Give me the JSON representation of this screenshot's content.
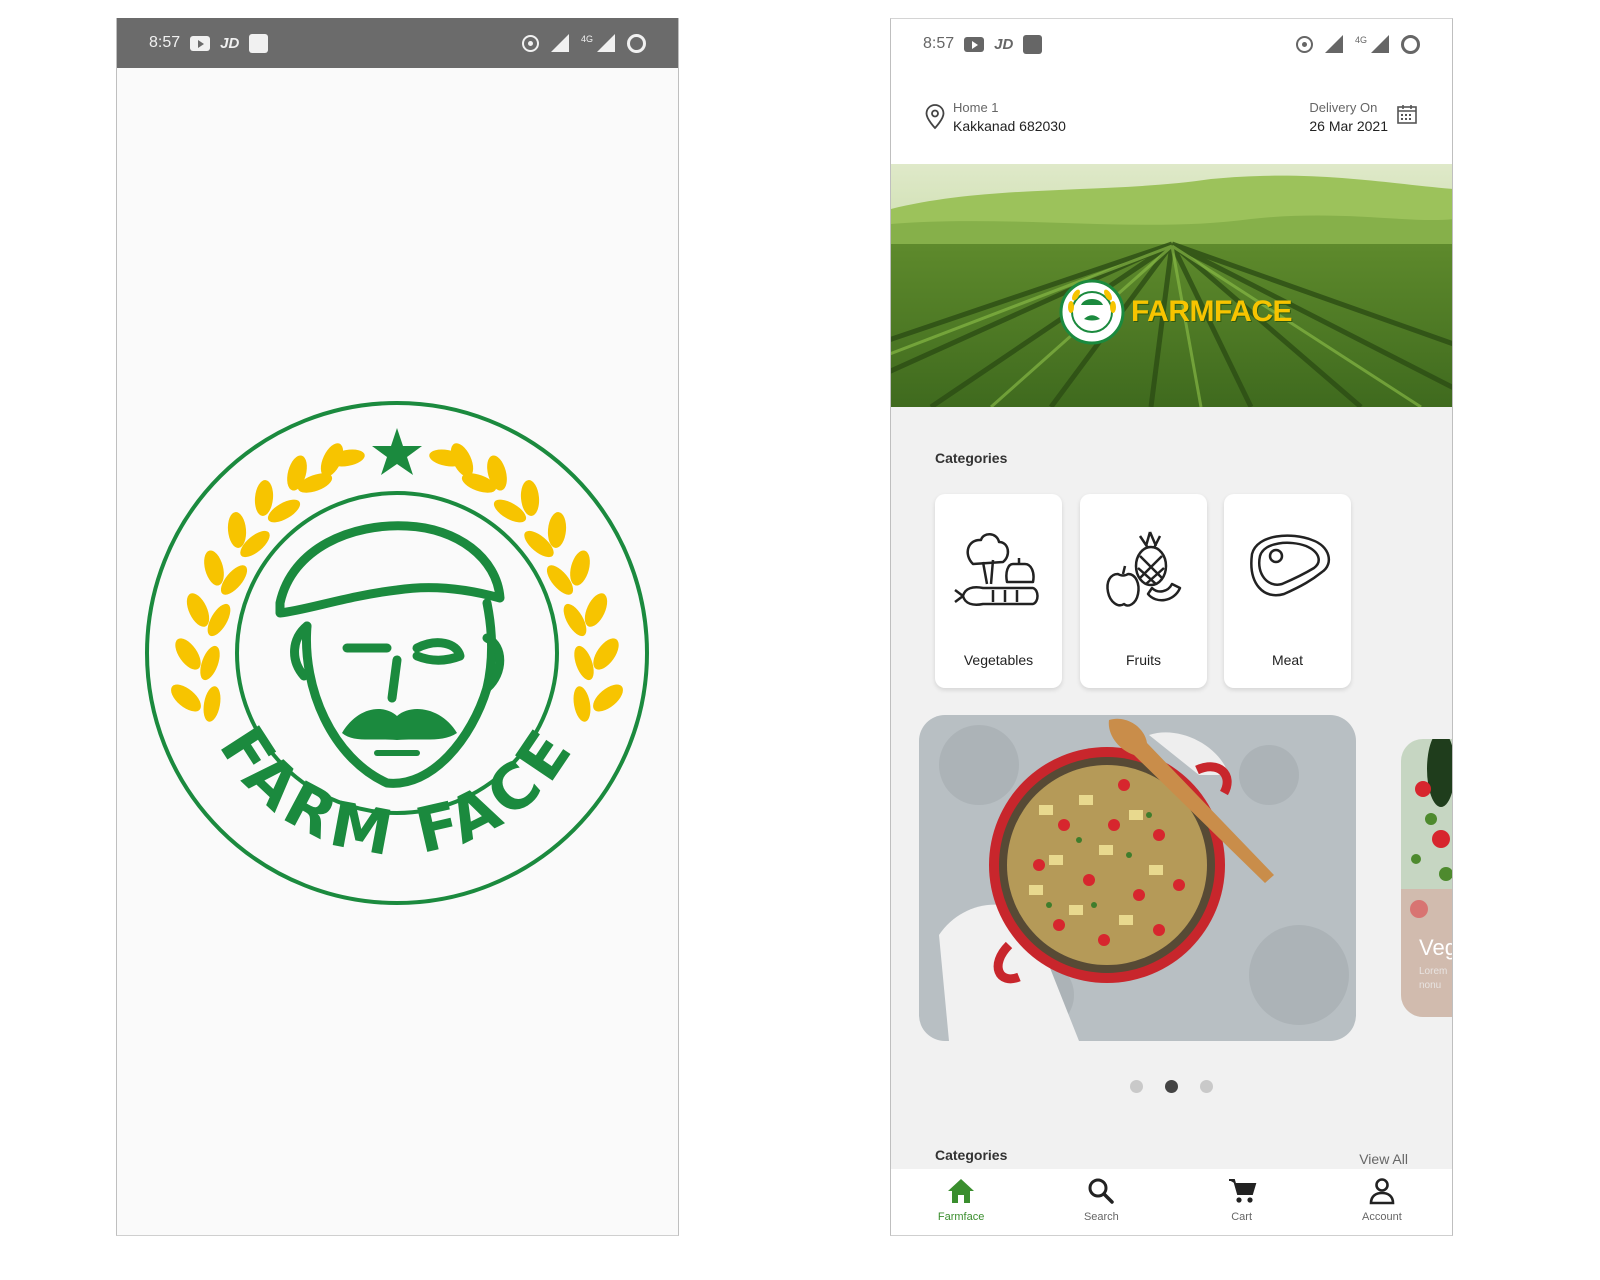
{
  "colors": {
    "brand_green": "#1b8a3e",
    "brand_yellow": "#f7c400",
    "nav_active": "#3a8e2e"
  },
  "splash": {
    "status_bar": {
      "time": "8:57",
      "carrier_mark": "JD",
      "network": "4G"
    },
    "logo": {
      "text": "FARM FACE"
    }
  },
  "home": {
    "status_bar": {
      "time": "8:57",
      "carrier_mark": "JD",
      "network": "4G"
    },
    "address": {
      "label": "Home 1",
      "value": "Kakkanad 682030"
    },
    "delivery": {
      "label": "Delivery On",
      "date": "26 Mar 2021"
    },
    "banner": {
      "brand_part1": "FARM",
      "brand_part2": "FACE"
    },
    "categories_title": "Categories",
    "categories": [
      {
        "label": "Vegetables",
        "icon": "vegetables-icon"
      },
      {
        "label": "Fruits",
        "icon": "fruits-icon"
      },
      {
        "label": "Meat",
        "icon": "meat-icon"
      }
    ],
    "promo_peek": {
      "title": "Veg",
      "subtitle_line1": "Lorem",
      "subtitle_line2": "nonu"
    },
    "carousel": {
      "count": 3,
      "active_index": 1
    },
    "second_section": {
      "title": "Categories",
      "view_all": "View All"
    },
    "bottom_nav": [
      {
        "label": "Farmface",
        "icon": "home-icon",
        "active": true
      },
      {
        "label": "Search",
        "icon": "search-icon",
        "active": false
      },
      {
        "label": "Cart",
        "icon": "cart-icon",
        "active": false
      },
      {
        "label": "Account",
        "icon": "account-icon",
        "active": false
      }
    ]
  }
}
